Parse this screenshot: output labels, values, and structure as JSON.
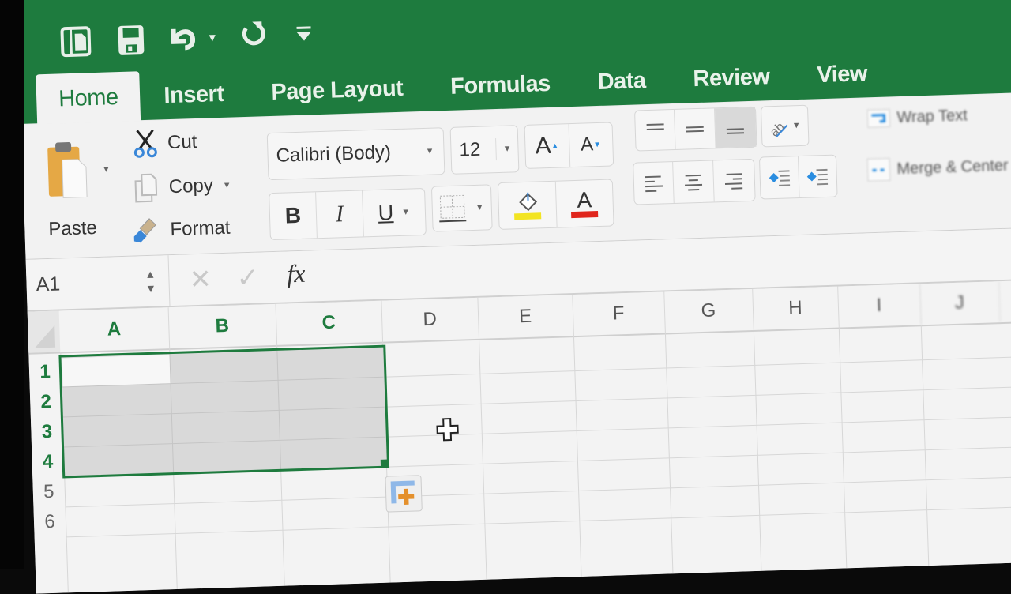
{
  "quick_access": {
    "icons": [
      "sidebar-icon",
      "save-icon",
      "undo-icon",
      "undo-dropdown",
      "redo-icon",
      "customize-toolbar-icon"
    ]
  },
  "tabs": [
    {
      "label": "Home",
      "active": true
    },
    {
      "label": "Insert"
    },
    {
      "label": "Page Layout"
    },
    {
      "label": "Formulas"
    },
    {
      "label": "Data"
    },
    {
      "label": "Review"
    },
    {
      "label": "View"
    }
  ],
  "clipboard": {
    "paste_label": "Paste",
    "cut_label": "Cut",
    "copy_label": "Copy",
    "format_label": "Format"
  },
  "font": {
    "family": "Calibri (Body)",
    "size": "12",
    "grow_label": "A",
    "shrink_label": "A",
    "bold_label": "B",
    "italic_label": "I",
    "underline_label": "U",
    "font_color_label": "A",
    "highlight_color": "#f2e422",
    "font_color": "#e0261d"
  },
  "alignment": {
    "wrap_text_label": "Wrap Text",
    "merge_center_label": "Merge & Center"
  },
  "formula_bar": {
    "name_box": "A1",
    "fx_label": "fx",
    "value": ""
  },
  "sheet": {
    "columns": [
      "A",
      "B",
      "C",
      "D",
      "E",
      "F",
      "G",
      "H",
      "I",
      "J"
    ],
    "rows": [
      "1",
      "2",
      "3",
      "4",
      "5",
      "6"
    ],
    "selected_range": "A1:C4",
    "active_cell": "A1"
  },
  "colors": {
    "accent": "#1e7b3e",
    "ribbon_bg": "#f2f2f2"
  }
}
